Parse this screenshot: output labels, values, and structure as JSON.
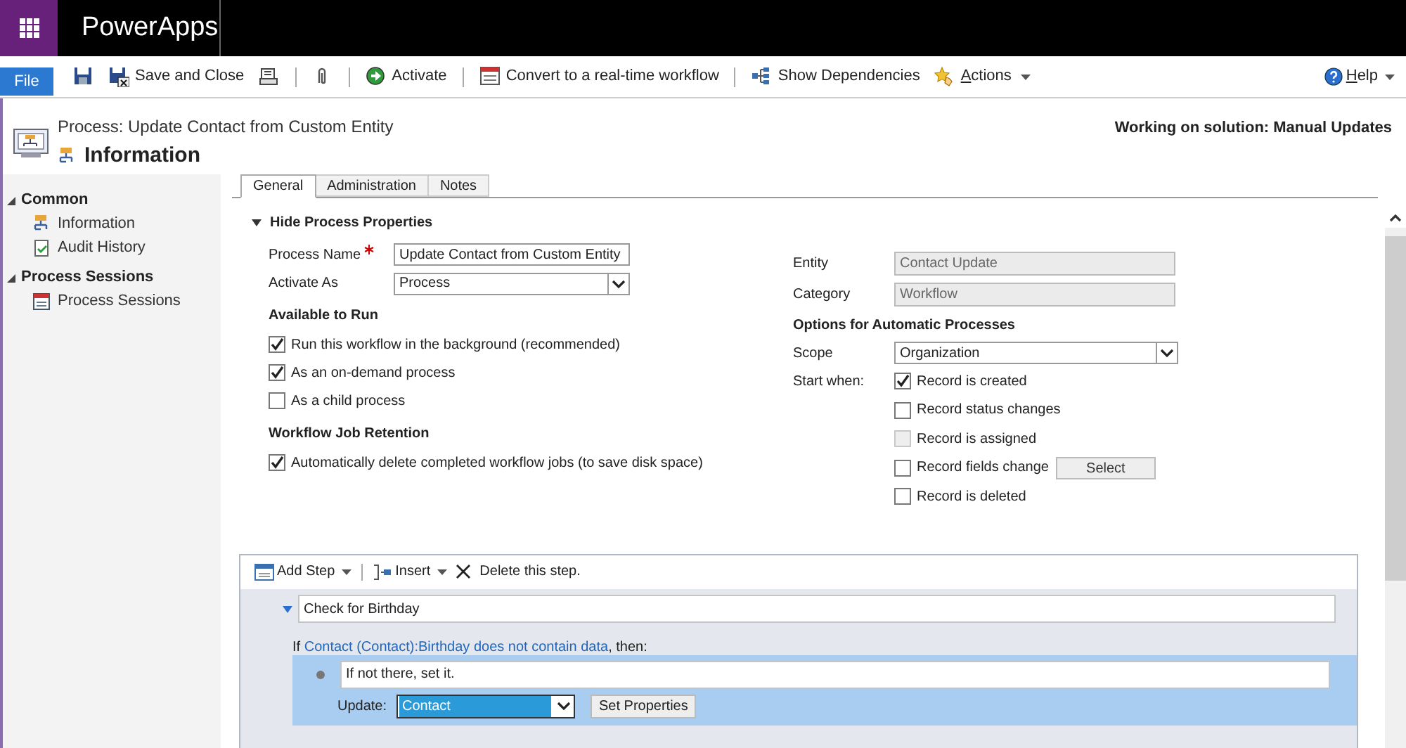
{
  "app_bar": {
    "app_name": "PowerApps"
  },
  "ribbon": {
    "file_tab": "File",
    "commands": [
      {
        "kind": "icon"
      },
      {
        "kind": "text",
        "label": "Save and Close"
      },
      {
        "kind": "icon"
      },
      {
        "kind": "separator"
      },
      {
        "kind": "icon"
      },
      {
        "kind": "separator"
      },
      {
        "kind": "text",
        "label": "Activate"
      },
      {
        "kind": "separator"
      },
      {
        "kind": "text",
        "label": "Convert to a real-time workflow"
      },
      {
        "kind": "separator"
      },
      {
        "kind": "text",
        "label": "Show Dependencies"
      },
      {
        "kind": "menu",
        "label": "Actions"
      }
    ],
    "help": "Help"
  },
  "header": {
    "breadcrumb": "Process: Update Contact from Custom Entity",
    "title": "Information",
    "solution": "Working on solution: Manual Updates"
  },
  "sidebar": {
    "groups": [
      {
        "label": "Common",
        "expanded": true,
        "children": [
          {
            "label": "Information"
          },
          {
            "label": "Audit History"
          }
        ]
      },
      {
        "label": "Process Sessions",
        "expanded": true,
        "children": [
          {
            "label": "Process Sessions"
          }
        ]
      }
    ]
  },
  "tabs": [
    {
      "label": "General",
      "selected": true
    },
    {
      "label": "Administration",
      "selected": false
    },
    {
      "label": "Notes",
      "selected": false
    }
  ],
  "section": {
    "label": "Hide Process Properties",
    "expanded": true
  },
  "left": {
    "process_name": {
      "label": "Process Name",
      "required": true,
      "value": "Update Contact from Custom Entity"
    },
    "activate_as": {
      "label": "Activate As",
      "value": "Process"
    },
    "groups": [
      {
        "heading": "Available to Run",
        "options": [
          {
            "label": "Run this workflow in the background (recommended)",
            "checked": true
          },
          {
            "label": "As an on-demand process",
            "checked": true
          },
          {
            "label": "As a child process",
            "checked": false
          }
        ]
      },
      {
        "heading": "Workflow Job Retention",
        "options": [
          {
            "label": "Automatically delete completed workflow jobs (to save disk space)",
            "checked": true
          }
        ]
      }
    ]
  },
  "right": {
    "entity": {
      "label": "Entity",
      "value": "Contact Update"
    },
    "category": {
      "label": "Category",
      "value": "Workflow"
    },
    "heading": "Options for Automatic Processes",
    "scope": {
      "label": "Scope",
      "value": "Organization"
    },
    "start_when": {
      "label": "Start when:",
      "options": [
        {
          "label": "Record is created",
          "checked": true,
          "disabled": false
        },
        {
          "label": "Record status changes",
          "checked": false,
          "disabled": false
        },
        {
          "label": "Record is assigned",
          "checked": false,
          "disabled": true
        },
        {
          "label": "Record fields change",
          "checked": false,
          "disabled": false,
          "button": "Select"
        },
        {
          "label": "Record is deleted",
          "checked": false,
          "disabled": false
        }
      ]
    }
  },
  "designer": {
    "toolbar": [
      {
        "kind": "add",
        "label": "Add Step",
        "dropdown": true
      },
      {
        "kind": "insert",
        "label": "Insert",
        "dropdown": true
      },
      {
        "kind": "delete",
        "label": "Delete this step.",
        "dropdown": false
      }
    ],
    "step": {
      "description": "Check for Birthday",
      "expanded": true,
      "condition": {
        "prefix": "If ",
        "link": "Contact (Contact):Birthday does not contain data",
        "suffix": ", then:"
      },
      "actions": [
        {
          "description": "If not there, set it.",
          "selected": true,
          "label": "Update:",
          "entity": "Contact",
          "button": "Set Properties"
        }
      ]
    }
  }
}
